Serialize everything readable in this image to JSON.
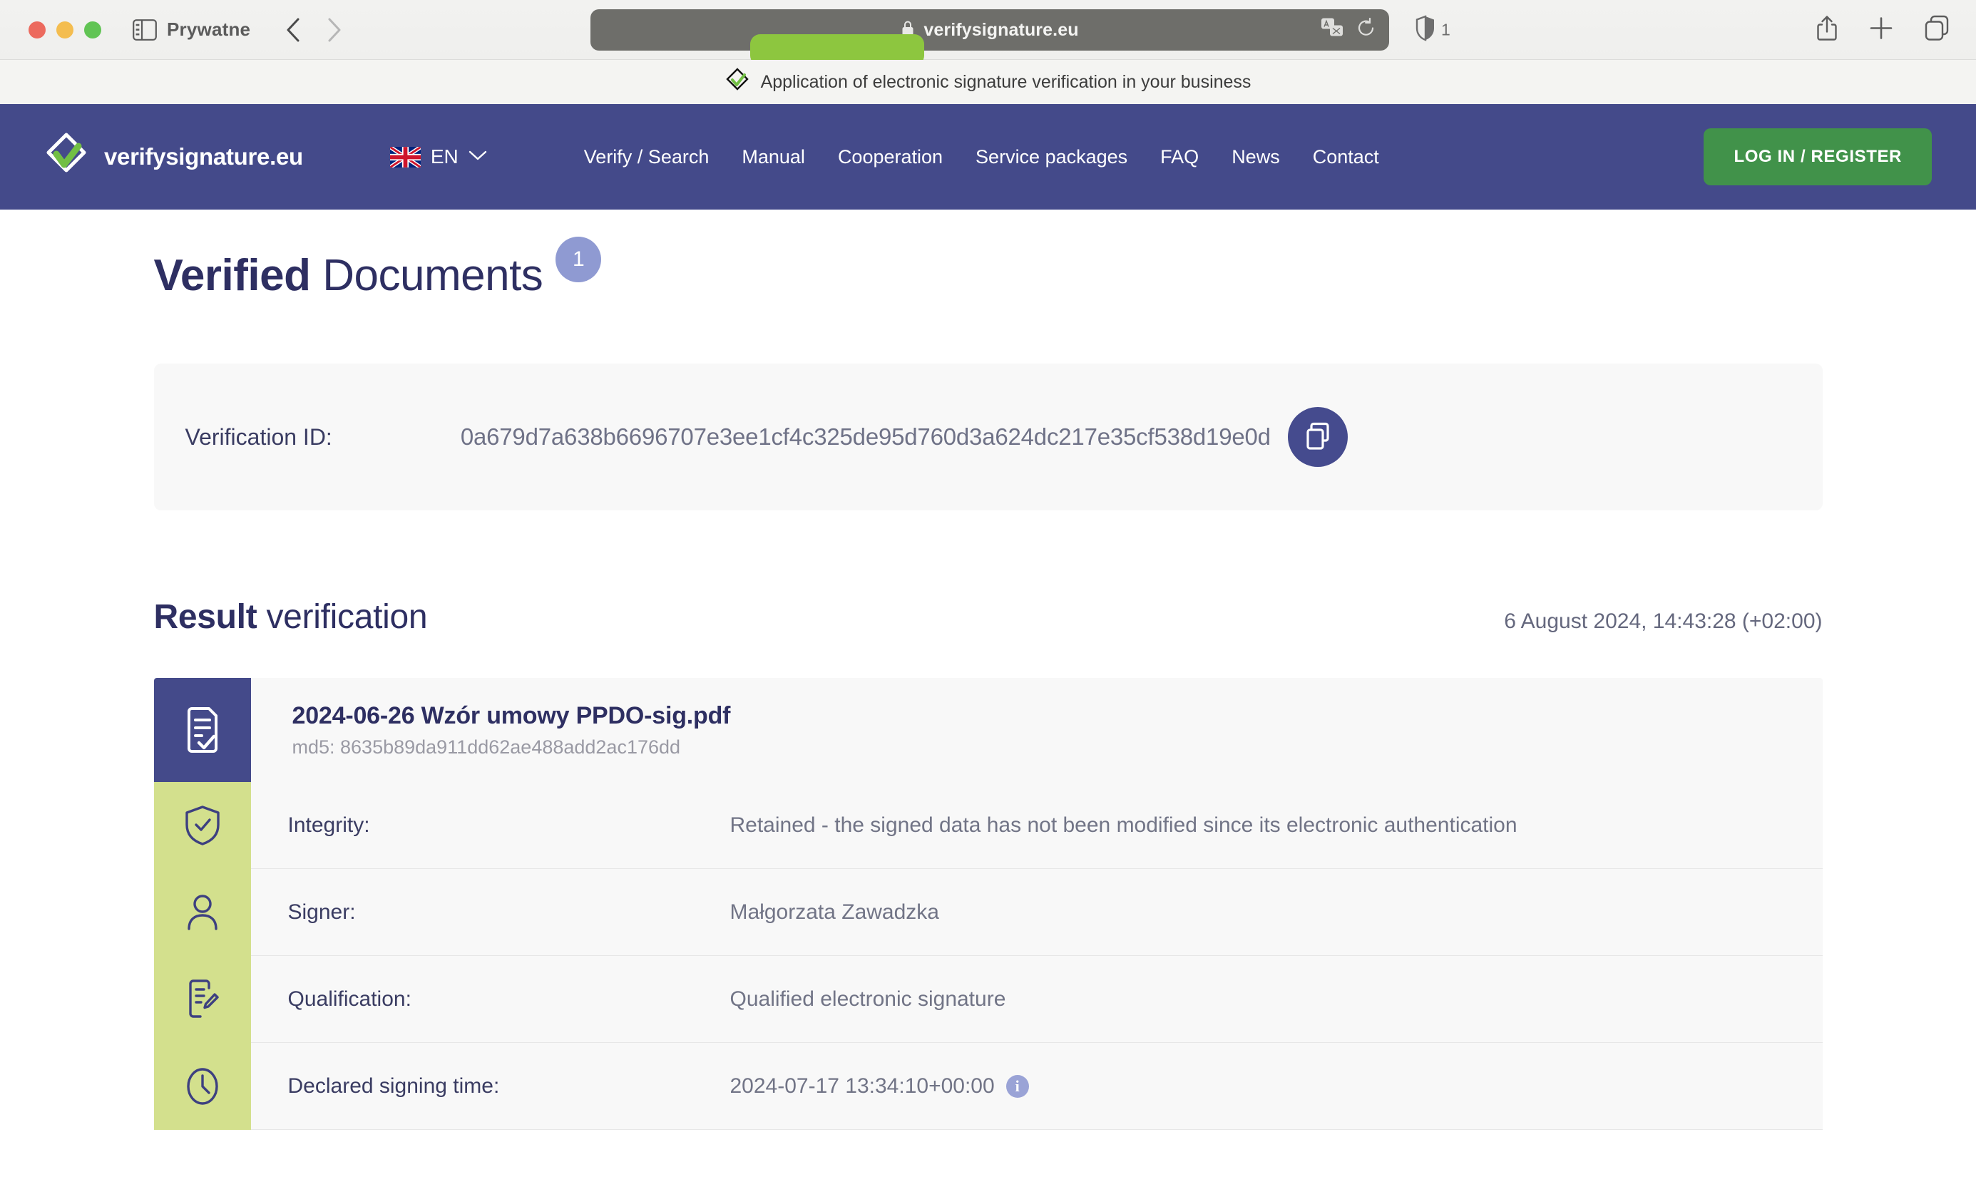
{
  "browser": {
    "tab_group_label": "Prywatne",
    "url": "verifysignature.eu",
    "shield_count": "1",
    "icons": {
      "sidebar": "sidebar-icon",
      "back": "back-chevron-icon",
      "forward": "forward-chevron-icon",
      "lock": "lock-icon",
      "translate": "translate-icon",
      "reload": "reload-icon",
      "shield": "privacy-shield-icon",
      "share": "share-icon",
      "new_tab": "plus-icon",
      "tab_overview": "tab-overview-icon"
    }
  },
  "top_banner": {
    "text": "Application of electronic signature verification in your business",
    "logo": "verifysignature-logo-icon"
  },
  "site_nav": {
    "brand": "verifysignature.eu",
    "language": "EN",
    "links": [
      "Verify / Search",
      "Manual",
      "Cooperation",
      "Service packages",
      "FAQ",
      "News",
      "Contact"
    ],
    "login_label": "LOG IN / REGISTER"
  },
  "main": {
    "title_strong": "Verified",
    "title_light": "Documents",
    "title_badge": "1",
    "verification": {
      "label": "Verification ID:",
      "id": "0a679d7a638b6696707e3ee1cf4c325de95d760d3a624dc217e35cf538d19e0d"
    },
    "result": {
      "title_strong": "Result",
      "title_light": "verification",
      "timestamp": "6 August 2024, 14:43:28 (+02:00)"
    },
    "document": {
      "name": "2024-06-26 Wzór umowy PPDO-sig.pdf",
      "md5": "md5: 8635b89da911dd62ae488add2ac176dd",
      "details": [
        {
          "icon": "shield-check-icon",
          "label": "Integrity:",
          "value": "Retained - the signed data has not been modified since its electronic authentication",
          "info": false
        },
        {
          "icon": "person-icon",
          "label": "Signer:",
          "value": "Małgorzata Zawadzka",
          "info": false
        },
        {
          "icon": "document-pen-icon",
          "label": "Qualification:",
          "value": "Qualified electronic signature",
          "info": false
        },
        {
          "icon": "clock-icon",
          "label": "Declared signing time:",
          "value": "2024-07-17 13:34:10+00:00",
          "info": true,
          "info_label": "i"
        }
      ]
    }
  },
  "colors": {
    "brand_navy": "#444a8a",
    "brand_green": "#41924a",
    "accent_lime": "#8dc63f",
    "icon_cell_green": "#d3e08d",
    "badge_lavender": "#8f9ad2",
    "title_navy": "#2e2f62"
  }
}
